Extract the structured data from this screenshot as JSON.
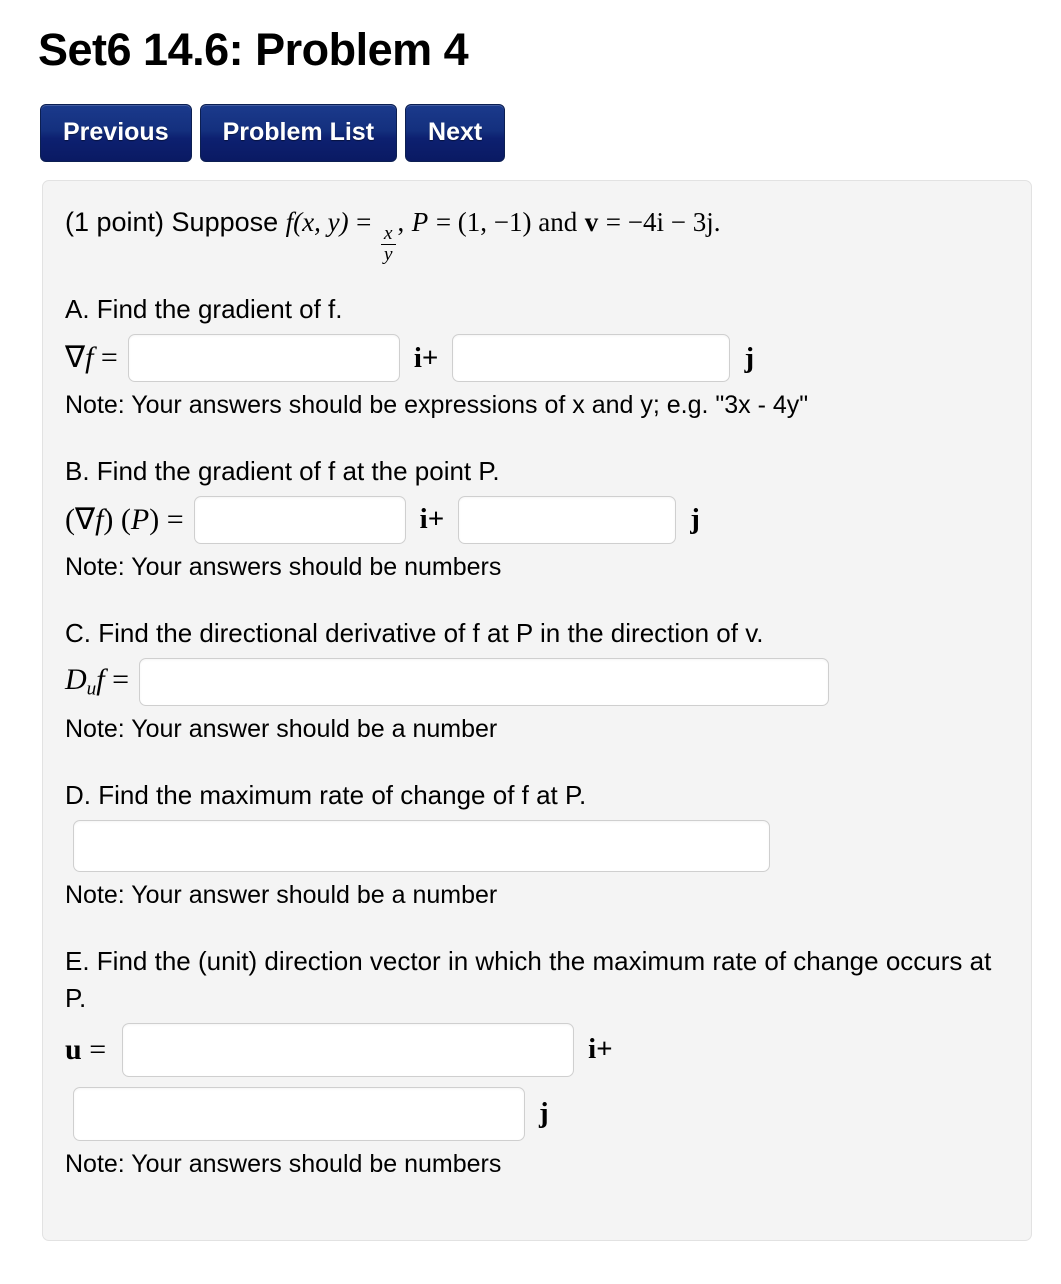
{
  "header": {
    "title": "Set6 14.6: Problem 4"
  },
  "nav": {
    "buttons": [
      {
        "label": "Previous",
        "name": "previous-button"
      },
      {
        "label": "Problem List",
        "name": "problem-list-button"
      },
      {
        "label": "Next",
        "name": "next-button"
      }
    ]
  },
  "problem": {
    "points_prefix": "(1 point) Suppose",
    "f_symbol": "f",
    "f_args": "(x, y)",
    "equals": "=",
    "frac_numerator": "x",
    "frac_denominator": "y",
    "comma": ",",
    "P_symbol": "P",
    "P_value": "= (1, −1) and",
    "v_symbol": "v",
    "v_value": "= −4i − 3j."
  },
  "sections": {
    "a": {
      "prompt": "A. Find the gradient of f.",
      "label_grad": "∇",
      "label_f": "f",
      "label_eq": " =",
      "input1_value": "",
      "input1_placeholder": "",
      "unit1": "i+",
      "input2_value": "",
      "input2_placeholder": "",
      "unit2": "j",
      "note": "Note: Your answers should be expressions of x and y; e.g. \"3x - 4y\""
    },
    "b": {
      "prompt": "B. Find the gradient of f at the point P.",
      "label_open": "(",
      "label_grad": "∇",
      "label_f": "f",
      "label_mid": ") (",
      "label_P": "P",
      "label_close": ") =",
      "input1_value": "",
      "input1_placeholder": "",
      "unit1": "i+",
      "input2_value": "",
      "input2_placeholder": "",
      "unit2": "j",
      "note": "Note: Your answers should be numbers"
    },
    "c": {
      "prompt": "C. Find the directional derivative of f at P in the direction of v.",
      "label_D": "D",
      "label_sub": "u",
      "label_f": "f",
      "label_eq": " =",
      "input_value": "",
      "input_placeholder": "",
      "note": "Note: Your answer should be a number"
    },
    "d": {
      "prompt": "D. Find the maximum rate of change of f at P.",
      "input_value": "",
      "input_placeholder": "",
      "note": "Note: Your answer should be a number"
    },
    "e": {
      "prompt": "E. Find the (unit) direction vector in which the maximum rate of change occurs at P.",
      "label_u": "u",
      "label_eq": " =",
      "input1_value": "",
      "input1_placeholder": "",
      "unit1": "i+",
      "input2_value": "",
      "input2_placeholder": "",
      "unit2": "j",
      "note": "Note: Your answers should be numbers"
    }
  },
  "colors": {
    "button_blue_top": "#1b3a8c",
    "button_blue_bottom": "#0a1a63",
    "panel_bg": "#f4f4f4",
    "panel_border": "#e2e2e2",
    "input_border": "#cfcfcf",
    "page_bg": "#ffffff"
  }
}
